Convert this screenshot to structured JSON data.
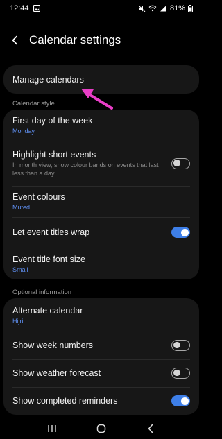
{
  "status": {
    "time": "12:44",
    "battery": "81%",
    "icons": [
      "gallery-icon",
      "mute-icon",
      "wifi-icon",
      "signal-icon",
      "battery-icon"
    ]
  },
  "header": {
    "title": "Calendar settings"
  },
  "manage": {
    "label": "Manage calendars"
  },
  "sections": {
    "calendar_style": "Calendar style",
    "optional_information": "Optional information"
  },
  "style_items": {
    "first_day": {
      "title": "First day of the week",
      "value": "Monday"
    },
    "highlight": {
      "title": "Highlight short events",
      "desc": "In month view, show colour bands on events that last less than a day.",
      "on": false
    },
    "event_colours": {
      "title": "Event colours",
      "value": "Muted"
    },
    "wrap_titles": {
      "title": "Let event titles wrap",
      "on": true
    },
    "font_size": {
      "title": "Event title font size",
      "value": "Small"
    }
  },
  "optional_items": {
    "alt_calendar": {
      "title": "Alternate calendar",
      "value": "Hijri"
    },
    "week_numbers": {
      "title": "Show week numbers",
      "on": false
    },
    "weather": {
      "title": "Show weather forecast",
      "on": false
    },
    "completed_reminders": {
      "title": "Show completed reminders",
      "on": true
    }
  },
  "colors": {
    "accent": "#3e7fe8",
    "annotation_arrow": "#e83ec6",
    "card": "#171717",
    "background": "#000000"
  }
}
